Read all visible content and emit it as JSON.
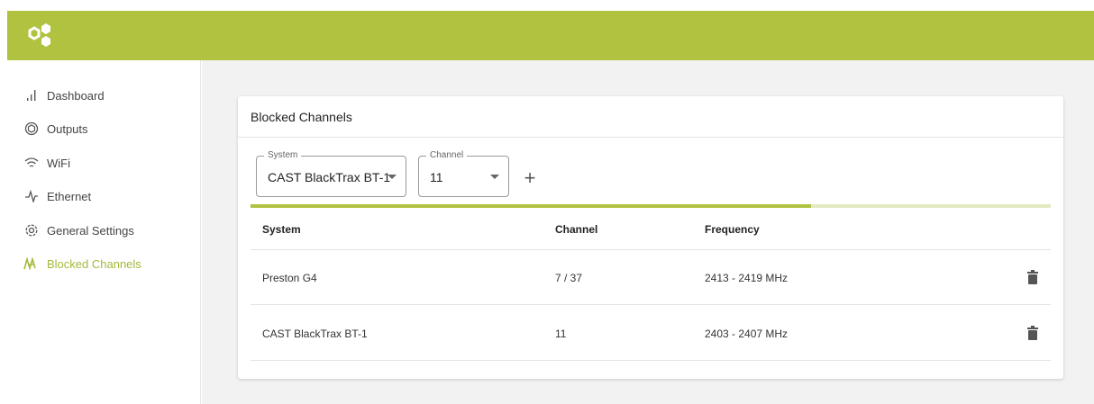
{
  "nav": [
    {
      "label": "Dashboard",
      "icon": "bar-chart-icon"
    },
    {
      "label": "Outputs",
      "icon": "aperture-icon"
    },
    {
      "label": "WiFi",
      "icon": "wifi-icon"
    },
    {
      "label": "Ethernet",
      "icon": "pulse-icon"
    },
    {
      "label": "General Settings",
      "icon": "gear-icon"
    },
    {
      "label": "Blocked Channels",
      "icon": "waveform-icon",
      "active": true
    }
  ],
  "card": {
    "title": "Blocked Channels",
    "system_field": {
      "label": "System",
      "value": "CAST BlackTrax BT-1"
    },
    "channel_field": {
      "label": "Channel",
      "value": "11"
    },
    "add_label": "+",
    "progress": 0.7
  },
  "table": {
    "headers": [
      "System",
      "Channel",
      "Frequency"
    ],
    "rows": [
      {
        "system": "Preston G4",
        "channel": "7 / 37",
        "frequency": "2413 - 2419 MHz"
      },
      {
        "system": "CAST BlackTrax BT-1",
        "channel": "11",
        "frequency": "2403 - 2407 MHz"
      }
    ]
  },
  "colors": {
    "accent": "#b0c240",
    "accent_light": "#e3eac0",
    "active_text": "#a6b83a"
  }
}
